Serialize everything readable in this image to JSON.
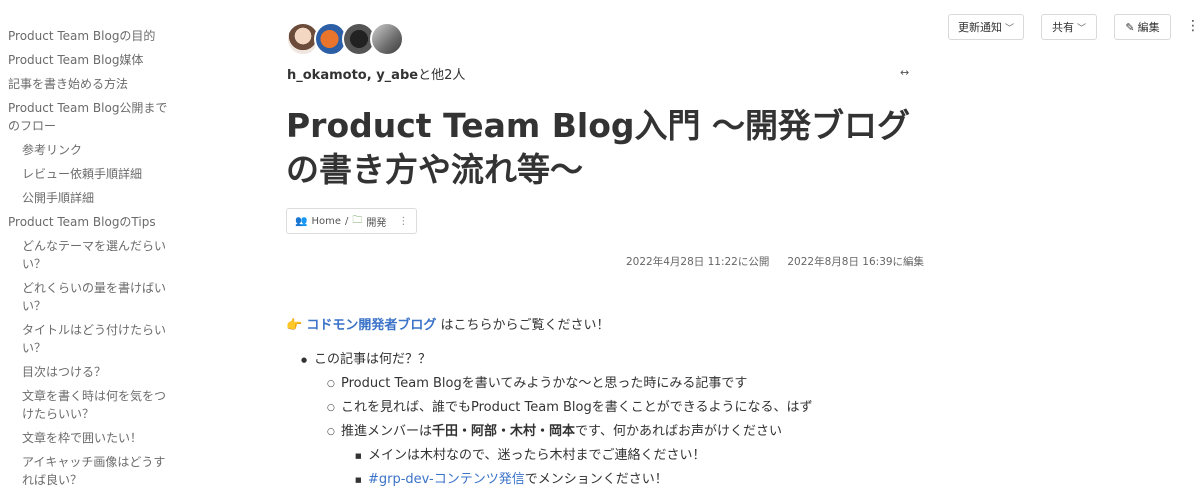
{
  "toc": {
    "items": [
      {
        "label": "Product Team Blogの目的",
        "level": 1
      },
      {
        "label": "Product Team Blog媒体",
        "level": 1
      },
      {
        "label": "記事を書き始める方法",
        "level": 1
      },
      {
        "label": "Product Team Blog公開までのフロー",
        "level": 1
      },
      {
        "label": "参考リンク",
        "level": 2
      },
      {
        "label": "レビュー依頼手順詳細",
        "level": 2
      },
      {
        "label": "公開手順詳細",
        "level": 2
      },
      {
        "label": "Product Team BlogのTips",
        "level": 1
      },
      {
        "label": "どんなテーマを選んだらいい？",
        "level": 2
      },
      {
        "label": "どれくらいの量を書けばいい？",
        "level": 2
      },
      {
        "label": "タイトルはどう付けたらいい？",
        "level": 2
      },
      {
        "label": "目次はつける？",
        "level": 2
      },
      {
        "label": "文章を書く時は何を気をつけたらいい？",
        "level": 2
      },
      {
        "label": "文章を枠で囲いたい！",
        "level": 2
      },
      {
        "label": "アイキャッチ画像はどうすれば良い？",
        "level": 2
      }
    ]
  },
  "header": {
    "authors_main": "h_okamoto, y_abe",
    "authors_rest": "と他2人",
    "notify_label": "更新通知",
    "share_label": "共有",
    "edit_label": "編集"
  },
  "article": {
    "title": "Product Team Blog入門 〜開発ブログの書き方や流れ等〜",
    "breadcrumb": {
      "home": "Home",
      "separator": "/",
      "folder": "開発"
    },
    "published": "2022年4月28日 11:22に公開",
    "edited": "2022年8月8日 16:39に編集",
    "intro_link": "コドモン開発者ブログ",
    "intro_text": " はこちらからご覧ください！",
    "list": {
      "q": "この記事は何だ？？",
      "a1": "Product Team Blogを書いてみようかな〜と思った時にみる記事です",
      "a2": "これを見れば、誰でもProduct Team Blogを書くことができるようになる、はず",
      "a3_pre": "推進メンバーは",
      "a3_names": "千田・阿部・木村・岡本",
      "a3_post": "です、何かあればお声がけください",
      "b1": "メインは木村なので、迷ったら木村までご連絡ください！",
      "b2_link": "#grp-dev-コンテンツ発信",
      "b2_post": "でメンションください！"
    }
  },
  "colors": {
    "link": "#3b73c8",
    "text": "#333333",
    "muted": "#6b6b6b"
  }
}
